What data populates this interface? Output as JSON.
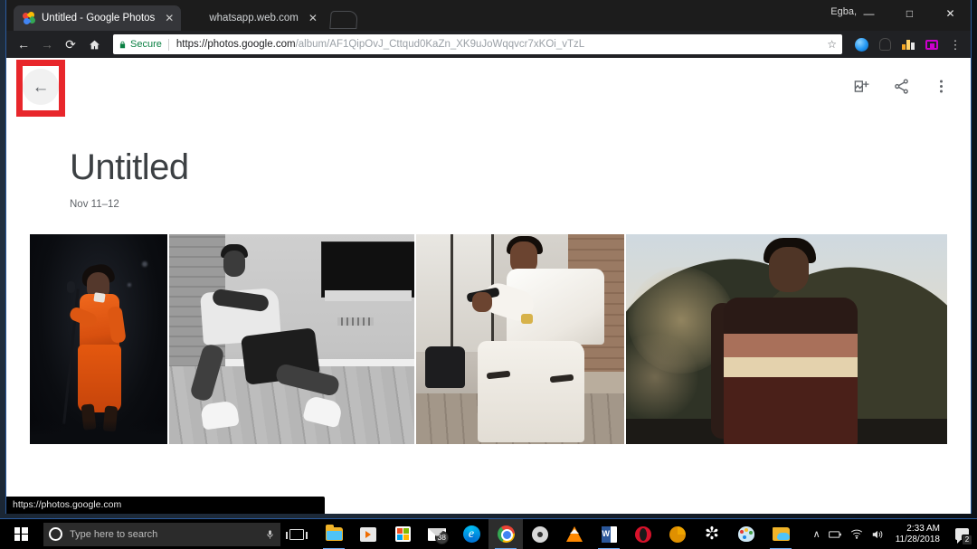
{
  "window": {
    "user_label": "Egba,",
    "controls": {
      "minimize": "—",
      "maximize": "□",
      "close": "✕"
    }
  },
  "tabs": [
    {
      "title": "Untitled - Google Photos",
      "favicon": "google-photos-icon",
      "active": true,
      "close": "✕"
    },
    {
      "title": "whatsapp.web.com",
      "favicon": "generic-page-icon",
      "active": false,
      "close": "✕"
    }
  ],
  "toolbar": {
    "back": "←",
    "forward": "→",
    "reload": "⟳",
    "home": "⌂",
    "security_label": "Secure",
    "lock": "ὑ2",
    "url_domain": "https://photos.google.com",
    "url_path": "/album/AF1QipOvJ_Cttqud0KaZn_XK9uJoWqqvcr7xKOi_vTzL",
    "url_full": "https://photos.google.com/album/AF1QipOvJ_Cttqud0KaZn_XK9uJoWqqvcr7xKOi_vTzL",
    "star": "☆",
    "extensions": [
      {
        "name": "profile-avatar-icon"
      },
      {
        "name": "ghost-extension-icon"
      },
      {
        "name": "bar-chart-extension-icon"
      },
      {
        "name": "tv-extension-icon"
      }
    ],
    "menu": "⋮"
  },
  "photos_app": {
    "back_button": "←",
    "actions": [
      {
        "name": "add-photos-button",
        "label": "Add photos"
      },
      {
        "name": "share-button",
        "label": "Share"
      },
      {
        "name": "more-options-button",
        "label": "More options"
      }
    ],
    "album": {
      "title": "Untitled",
      "date_range": "Nov 11–12"
    },
    "photos": [
      {
        "alt": "Performer in orange jumpsuit singing into a microphone on a dark stage"
      },
      {
        "alt": "Black and white photo of a man seated on the floor against a brick wall"
      },
      {
        "alt": "Man in a white outfit seated on a bench holding sunglasses"
      },
      {
        "alt": "Man in a striped sweater standing in hills at golden hour"
      }
    ]
  },
  "status_bar": {
    "url": "https://photos.google.com"
  },
  "taskbar": {
    "search_placeholder": "Type here to search",
    "cortana": "cortana-icon",
    "mic": "Ἲ4",
    "task_view": "task-view-icon",
    "apps": [
      {
        "name": "file-explorer",
        "label": "File Explorer",
        "running": true
      },
      {
        "name": "media-player",
        "label": "Movies & TV",
        "running": false
      },
      {
        "name": "microsoft-store",
        "label": "Microsoft Store",
        "running": false
      },
      {
        "name": "mail",
        "label": "Mail",
        "running": false,
        "badge": "38"
      },
      {
        "name": "microsoft-edge",
        "label": "Microsoft Edge",
        "running": false
      },
      {
        "name": "google-chrome",
        "label": "Google Chrome",
        "running": true,
        "active": true
      },
      {
        "name": "disc-utility",
        "label": "Disc utility",
        "running": false
      },
      {
        "name": "vlc-media-player",
        "label": "VLC media player",
        "running": false
      },
      {
        "name": "microsoft-word",
        "label": "Microsoft Word",
        "running": true
      },
      {
        "name": "opera-browser",
        "label": "Opera",
        "running": false
      },
      {
        "name": "clock-app",
        "label": "Clock",
        "running": false
      },
      {
        "name": "settings",
        "label": "Settings",
        "running": false
      },
      {
        "name": "paint",
        "label": "Paint",
        "running": false
      },
      {
        "name": "onedrive-folder",
        "label": "OneDrive",
        "running": true
      }
    ],
    "tray": {
      "show_hidden": "∧",
      "battery": "battery-icon",
      "network": "wifi-icon",
      "volume": "ὐA",
      "time": "2:33 AM",
      "date": "11/28/2018",
      "notification_count": "2"
    }
  },
  "colors": {
    "annotation": "#e8262b",
    "chrome_dark": "#202124",
    "secure_green": "#0b8043",
    "taskbar": "#000000"
  }
}
